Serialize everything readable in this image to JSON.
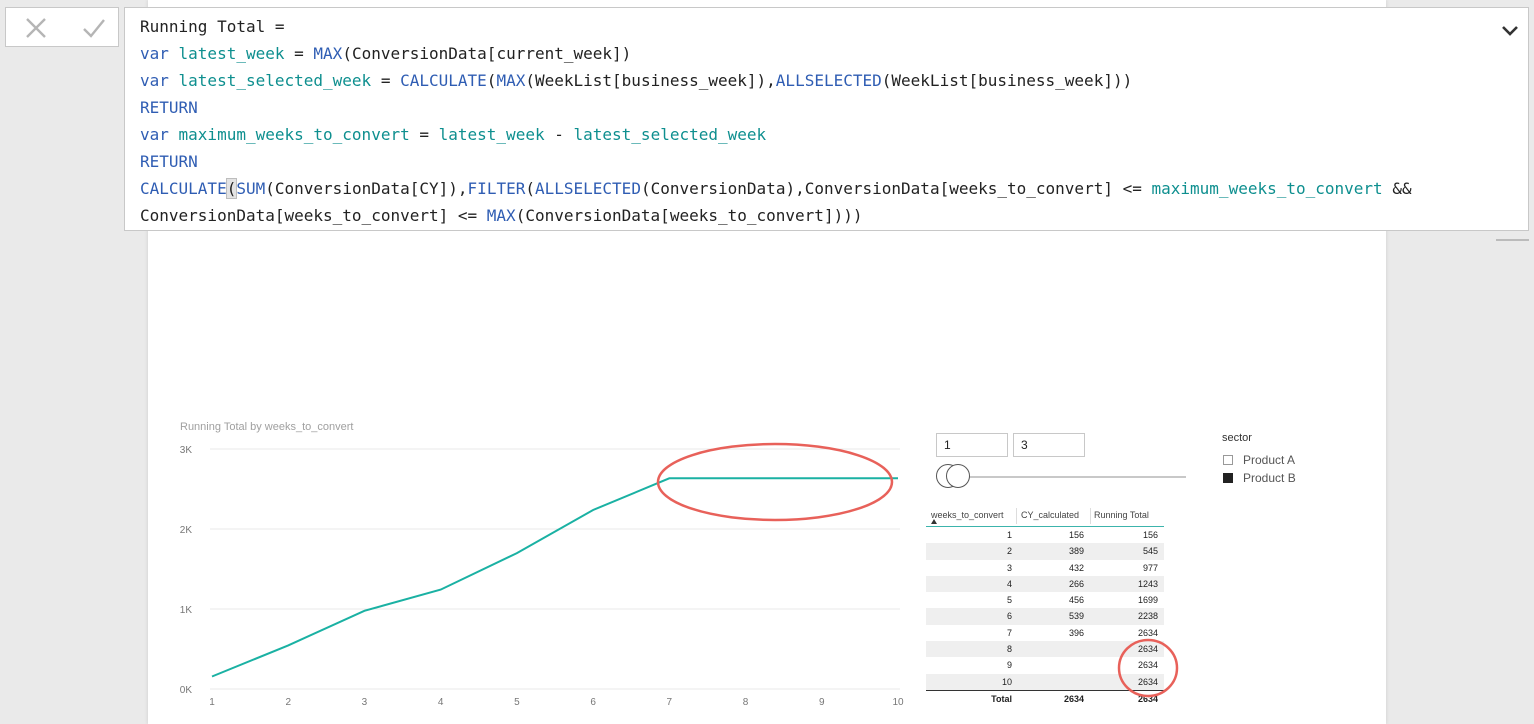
{
  "toolbar": {
    "cancel_icon": "close-icon",
    "commit_icon": "check-icon",
    "expand_icon": "chevron-down-icon"
  },
  "formula": {
    "lines": [
      [
        {
          "t": "Running Total = ",
          "c": "plain"
        }
      ],
      [
        {
          "t": "var ",
          "c": "kw"
        },
        {
          "t": "latest_week",
          "c": "var"
        },
        {
          "t": " = ",
          "c": "plain"
        },
        {
          "t": "MAX",
          "c": "fn"
        },
        {
          "t": "(ConversionData[current_week])",
          "c": "plain"
        }
      ],
      [
        {
          "t": "var ",
          "c": "kw"
        },
        {
          "t": "latest_selected_week",
          "c": "var"
        },
        {
          "t": " = ",
          "c": "plain"
        },
        {
          "t": "CALCULATE",
          "c": "fn"
        },
        {
          "t": "(",
          "c": "plain"
        },
        {
          "t": "MAX",
          "c": "fn"
        },
        {
          "t": "(WeekList[business_week]),",
          "c": "plain"
        },
        {
          "t": "ALLSELECTED",
          "c": "fn"
        },
        {
          "t": "(WeekList[business_week]))",
          "c": "plain"
        }
      ],
      [
        {
          "t": "RETURN",
          "c": "kw"
        }
      ],
      [
        {
          "t": "var ",
          "c": "kw"
        },
        {
          "t": "maximum_weeks_to_convert",
          "c": "var"
        },
        {
          "t": " = ",
          "c": "plain"
        },
        {
          "t": "latest_week",
          "c": "var"
        },
        {
          "t": " - ",
          "c": "plain"
        },
        {
          "t": "latest_selected_week",
          "c": "var"
        }
      ],
      [
        {
          "t": "RETURN",
          "c": "kw"
        }
      ],
      [
        {
          "t": "CALCULATE",
          "c": "fn"
        },
        {
          "t": "(",
          "c": "cursor"
        },
        {
          "t": "SUM",
          "c": "fn"
        },
        {
          "t": "(ConversionData[CY]),",
          "c": "plain"
        },
        {
          "t": "FILTER",
          "c": "fn"
        },
        {
          "t": "(",
          "c": "plain"
        },
        {
          "t": "ALLSELECTED",
          "c": "fn"
        },
        {
          "t": "(ConversionData),ConversionData[weeks_to_convert] <= ",
          "c": "plain"
        },
        {
          "t": "maximum_weeks_to_convert",
          "c": "var"
        },
        {
          "t": " &&",
          "c": "plain"
        }
      ],
      [
        {
          "t": "ConversionData[weeks_to_convert] <= ",
          "c": "plain"
        },
        {
          "t": "MAX",
          "c": "fn"
        },
        {
          "t": "(ConversionData[weeks_to_convert])))",
          "c": "plain"
        }
      ]
    ]
  },
  "chart": {
    "title": "Running Total by weeks_to_convert",
    "line_color": "#1ab1a3",
    "highlight_color": "#e8615a"
  },
  "chart_data": {
    "type": "line",
    "title": "Running Total by weeks_to_convert",
    "xlabel": "",
    "ylabel": "",
    "x": [
      1,
      2,
      3,
      4,
      5,
      6,
      7,
      8,
      9,
      10
    ],
    "series": [
      {
        "values": [
          156,
          545,
          977,
          1243,
          1699,
          2238,
          2634,
          2634,
          2634,
          2634
        ]
      }
    ],
    "ylim": [
      0,
      3000
    ],
    "y_ticks": [
      "0K",
      "1K",
      "2K",
      "3K"
    ],
    "x_ticks": [
      "1",
      "2",
      "3",
      "4",
      "5",
      "6",
      "7",
      "8",
      "9",
      "10"
    ],
    "grid": true
  },
  "slicer": {
    "min_value": "1",
    "max_value": "3",
    "range_start": 1,
    "range_end": 3,
    "range_min": 1,
    "range_max": 52
  },
  "sector": {
    "title": "sector",
    "items": [
      {
        "label": "Product A",
        "selected": false
      },
      {
        "label": "Product B",
        "selected": true
      }
    ]
  },
  "table": {
    "headers": [
      "weeks_to_convert",
      "CY_calculated",
      "Running Total"
    ],
    "rows": [
      [
        "1",
        "156",
        "156"
      ],
      [
        "2",
        "389",
        "545"
      ],
      [
        "3",
        "432",
        "977"
      ],
      [
        "4",
        "266",
        "1243"
      ],
      [
        "5",
        "456",
        "1699"
      ],
      [
        "6",
        "539",
        "2238"
      ],
      [
        "7",
        "396",
        "2634"
      ],
      [
        "8",
        "",
        "2634"
      ],
      [
        "9",
        "",
        "2634"
      ],
      [
        "10",
        "",
        "2634"
      ]
    ],
    "total": [
      "Total",
      "2634",
      "2634"
    ]
  }
}
